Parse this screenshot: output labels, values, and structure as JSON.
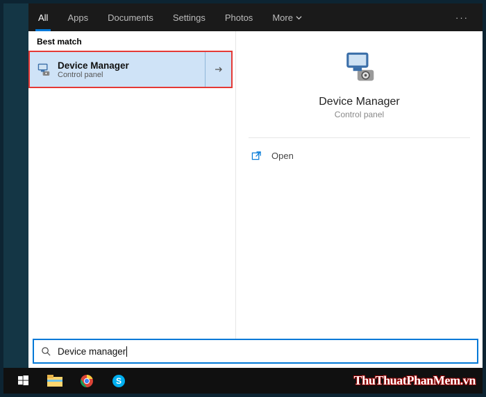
{
  "tabs": {
    "all": "All",
    "apps": "Apps",
    "documents": "Documents",
    "settings": "Settings",
    "photos": "Photos",
    "more": "More"
  },
  "section": {
    "best_match": "Best match"
  },
  "result": {
    "title": "Device Manager",
    "subtitle": "Control panel"
  },
  "detail": {
    "title": "Device Manager",
    "subtitle": "Control panel"
  },
  "actions": {
    "open": "Open"
  },
  "search": {
    "query": "Device manager"
  },
  "watermark": "ThuThuatPhanMem.vn"
}
